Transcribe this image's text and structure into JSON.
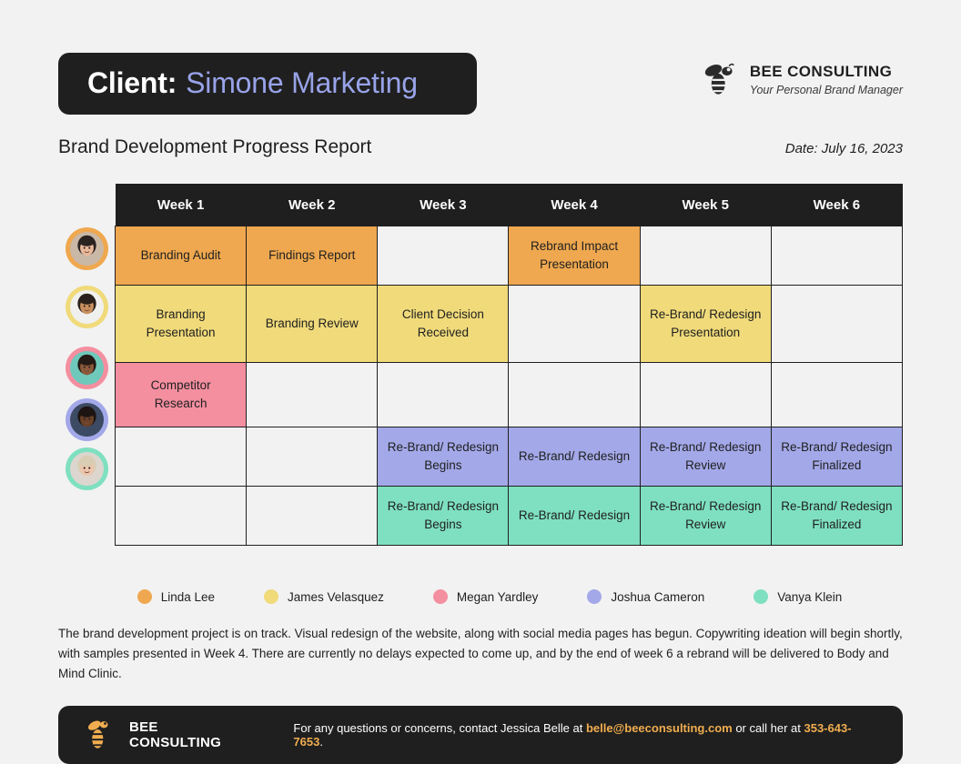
{
  "header": {
    "client_label": "Client:",
    "client_name": "Simone Marketing",
    "brand_name": "BEE CONSULTING",
    "brand_tagline": "Your Personal Brand Manager",
    "logo_icon": "bee-icon"
  },
  "subtitle": {
    "report_title": "Brand Development Progress Report",
    "date": "Date: July 16, 2023"
  },
  "colors": {
    "orange": "#efa84f",
    "yellow": "#f0da7a",
    "pink": "#f48fa0",
    "purple": "#a3a8e8",
    "teal": "#7ee0c0",
    "dark": "#1f1f1f",
    "page_bg": "#f2f2f2",
    "cell_empty": "#f2f2f2",
    "accent": "#f0ad4f",
    "client_name_color": "#98a3e8"
  },
  "table": {
    "columns": [
      "Week 1",
      "Week 2",
      "Week 3",
      "Week 4",
      "Week 5",
      "Week 6"
    ],
    "rows": [
      {
        "person": "Linda Lee",
        "color": "#efa84f",
        "avatar_name": "avatar-linda-lee",
        "cells": [
          "Branding Audit",
          "Findings Report",
          "",
          "Rebrand Impact Presentation",
          "",
          ""
        ]
      },
      {
        "person": "James Velasquez",
        "color": "#f0da7a",
        "avatar_name": "avatar-james-velasquez",
        "cells": [
          "Branding Presentation",
          "Branding Review",
          "Client Decision Received",
          "",
          "Re-Brand/ Redesign Presentation",
          ""
        ]
      },
      {
        "person": "Megan Yardley",
        "color": "#f48fa0",
        "avatar_name": "avatar-megan-yardley",
        "cells": [
          "Competitor Research",
          "",
          "",
          "",
          "",
          ""
        ]
      },
      {
        "person": "Joshua Cameron",
        "color": "#a3a8e8",
        "avatar_name": "avatar-joshua-cameron",
        "cells": [
          "",
          "",
          "Re-Brand/ Redesign Begins",
          "Re-Brand/ Redesign",
          "Re-Brand/ Redesign Review",
          "Re-Brand/ Redesign Finalized"
        ]
      },
      {
        "person": "Vanya Klein",
        "color": "#7ee0c0",
        "avatar_name": "avatar-vanya-klein",
        "cells": [
          "",
          "",
          "Re-Brand/ Redesign Begins",
          "Re-Brand/ Redesign",
          "Re-Brand/ Redesign Review",
          "Re-Brand/ Redesign Finalized"
        ]
      }
    ]
  },
  "legend": [
    {
      "label": "Linda Lee",
      "color": "#efa84f"
    },
    {
      "label": "James Velasquez",
      "color": "#f0da7a"
    },
    {
      "label": "Megan Yardley",
      "color": "#f48fa0"
    },
    {
      "label": "Joshua Cameron",
      "color": "#a3a8e8"
    },
    {
      "label": "Vanya Klein",
      "color": "#7ee0c0"
    }
  ],
  "summary": "The brand development project is on track. Visual redesign of the website, along with social media pages has begun. Copywriting ideation will begin shortly, with samples presented in Week 4. There are currently no delays expected to come up, and by the end of week 6 a rebrand will be delivered to Body and Mind Clinic.",
  "footer": {
    "brand_name": "BEE CONSULTING",
    "logo_icon": "bee-icon",
    "message_prefix": "For any questions or concerns, contact Jessica Belle at ",
    "email": "belle@beeconsulting.com",
    "message_middle": " or call her at ",
    "phone": "353-643-7653",
    "message_suffix": "."
  }
}
